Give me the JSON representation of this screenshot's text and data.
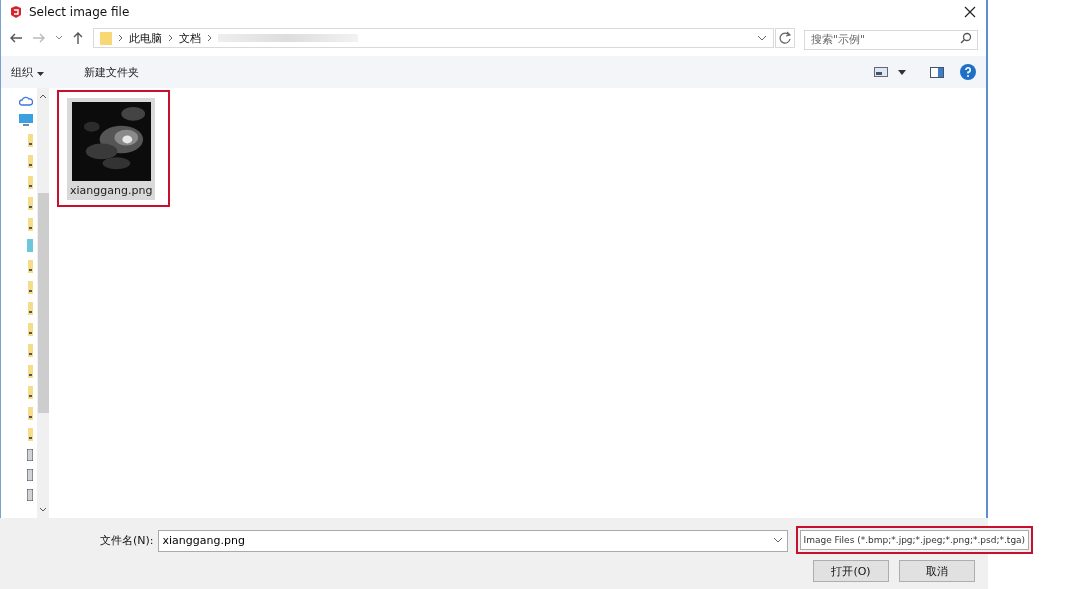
{
  "window": {
    "title": "Select image file"
  },
  "breadcrumb": [
    "此电脑",
    "文档"
  ],
  "search": {
    "placeholder": "搜索\"示例\""
  },
  "toolbar": {
    "organize": "组织",
    "new_folder": "新建文件夹"
  },
  "sidebar": {
    "items": [
      {
        "kind": "cloud"
      },
      {
        "kind": "computer"
      },
      {
        "kind": "folder"
      },
      {
        "kind": "folder"
      },
      {
        "kind": "folder"
      },
      {
        "kind": "folder"
      },
      {
        "kind": "folder"
      },
      {
        "kind": "desktop"
      },
      {
        "kind": "folder"
      },
      {
        "kind": "folder"
      },
      {
        "kind": "folder"
      },
      {
        "kind": "folder"
      },
      {
        "kind": "folder"
      },
      {
        "kind": "folder"
      },
      {
        "kind": "folder"
      },
      {
        "kind": "folder"
      },
      {
        "kind": "folder"
      },
      {
        "kind": "drive"
      },
      {
        "kind": "drive"
      },
      {
        "kind": "drive"
      }
    ]
  },
  "files": [
    {
      "name": "xianggang.png",
      "kind": "picture",
      "selected": true
    }
  ],
  "filename": {
    "label": "文件名(N):",
    "value": "xianggang.png"
  },
  "filter": {
    "value": "Image Files (*.bmp;*.jpg;*.jpeg;*.png;*.psd;*.tga)"
  },
  "buttons": {
    "open": "打开(O)",
    "cancel": "取消"
  }
}
